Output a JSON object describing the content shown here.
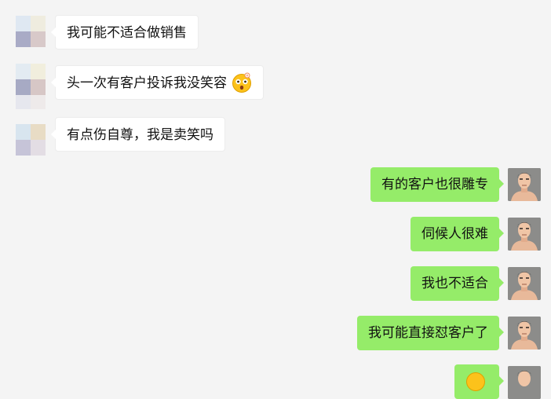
{
  "messages": [
    {
      "side": "in",
      "text": "我可能不适合做销售"
    },
    {
      "side": "in",
      "text": "头一次有客户投诉我没笑容",
      "emoji": "flushed-face-emoji"
    },
    {
      "side": "in",
      "text": "有点伤自尊，我是卖笑吗"
    },
    {
      "side": "out",
      "text": "有的客户也很雕专"
    },
    {
      "side": "out",
      "text": "伺候人很难"
    },
    {
      "side": "out",
      "text": "我也不适合"
    },
    {
      "side": "out",
      "text": "我可能直接怼客户了"
    },
    {
      "side": "out",
      "emoji": "smile-face-emoji"
    }
  ],
  "colors": {
    "background": "#f4f4f4",
    "incoming_bubble": "#ffffff",
    "outgoing_bubble": "#95ec69"
  }
}
